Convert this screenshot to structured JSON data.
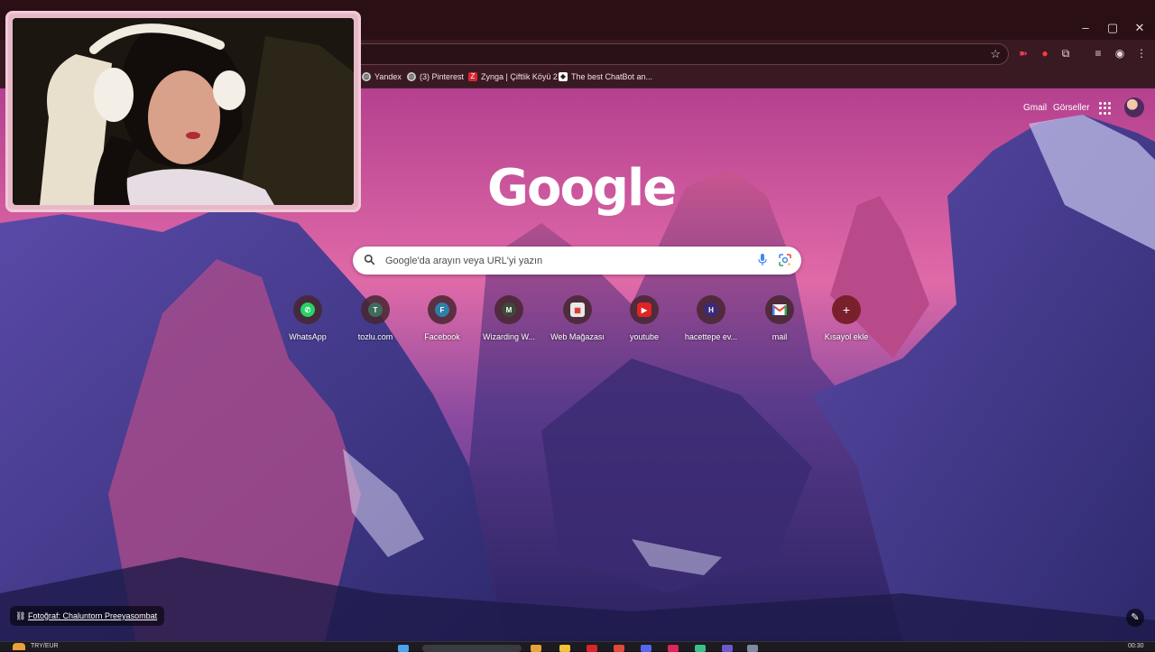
{
  "browser": {
    "window_controls": {
      "minimize": "–",
      "maximize": "▢",
      "close": "✕"
    },
    "bookmarks": [
      {
        "label": "Yandex",
        "icon": "globe-icon"
      },
      {
        "label": "(3) Pinterest",
        "icon": "globe-icon"
      },
      {
        "label": "Zynga | Çiftlik Köyü 2",
        "icon": "zynga-icon"
      },
      {
        "label": "The best ChatBot an...",
        "icon": "chatbot-icon"
      }
    ]
  },
  "header": {
    "gmail": "Gmail",
    "images": "Görseller"
  },
  "logo": "Google",
  "search": {
    "placeholder": "Google'da arayın veya URL'yi yazın"
  },
  "shortcuts": [
    {
      "label": "WhatsApp",
      "letter": "",
      "color": "#25d366"
    },
    {
      "label": "tozlu.com",
      "letter": "T",
      "color": "#3f6b5a"
    },
    {
      "label": "Facebook",
      "letter": "F",
      "color": "#2f7fa8"
    },
    {
      "label": "Wizarding W...",
      "letter": "M",
      "color": "#3d4a3a"
    },
    {
      "label": "Web Mağazası",
      "letter": "",
      "color": "#e8e8e8"
    },
    {
      "label": "youtube",
      "letter": "",
      "color": "#e02424"
    },
    {
      "label": "hacettepe ev...",
      "letter": "H",
      "color": "#3a2a7a"
    },
    {
      "label": "mail",
      "letter": "",
      "color": "#ffffff"
    },
    {
      "label": "Kısayol ekle",
      "letter": "+",
      "color": "#7a1f2c"
    }
  ],
  "attribution": "Fotoğraf: Chaluntorn Preeyasombat",
  "taskbar": {
    "currency": "TRY/EUR",
    "time": "00:30"
  },
  "colors": {
    "chrome_bg": "#3a1a22",
    "title_bg": "#2a1015",
    "wallpaper_sky": "#c04a9a",
    "accent_pink": "#f2c9d6"
  }
}
